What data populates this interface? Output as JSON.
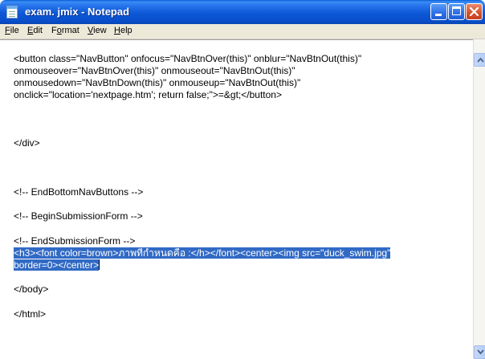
{
  "window": {
    "title": "exam. jmix - Notepad",
    "icon": "notepad-icon",
    "title_color": "#ffffff",
    "titlebar_color": "#0a58d6"
  },
  "menu": [
    {
      "label": "File",
      "accel": "F",
      "rest": "ile"
    },
    {
      "label": "Edit",
      "accel": "E",
      "rest": "dit"
    },
    {
      "label": "Format",
      "accel": "o",
      "pre": "F",
      "rest": "rmat"
    },
    {
      "label": "View",
      "accel": "V",
      "rest": "iew"
    },
    {
      "label": "Help",
      "accel": "H",
      "rest": "elp"
    }
  ],
  "document": {
    "lines": [
      "<button class=\"NavButton\" onfocus=\"NavBtnOver(this)\" onblur=\"NavBtnOut(this)\"",
      "onmouseover=\"NavBtnOver(this)\" onmouseout=\"NavBtnOut(this)\"",
      "onmousedown=\"NavBtnDown(this)\" onmouseup=\"NavBtnOut(this)\"",
      "onclick=\"location='nextpage.htm'; return false;\">=&gt;</button>",
      "</div>",
      "<!-- EndBottomNavButtons -->",
      "<!-- BeginSubmissionForm -->",
      "<!-- EndSubmissionForm -->"
    ],
    "selected_lines": [
      "<h3><font color=brown>ภาพที่กำหนดคือ :</h></font><center><img src=\"duck_swim.jpg\"",
      "border=0></center>"
    ],
    "tail_lines": [
      "</body>",
      "</html>"
    ],
    "selection_color": "#316ac5"
  }
}
